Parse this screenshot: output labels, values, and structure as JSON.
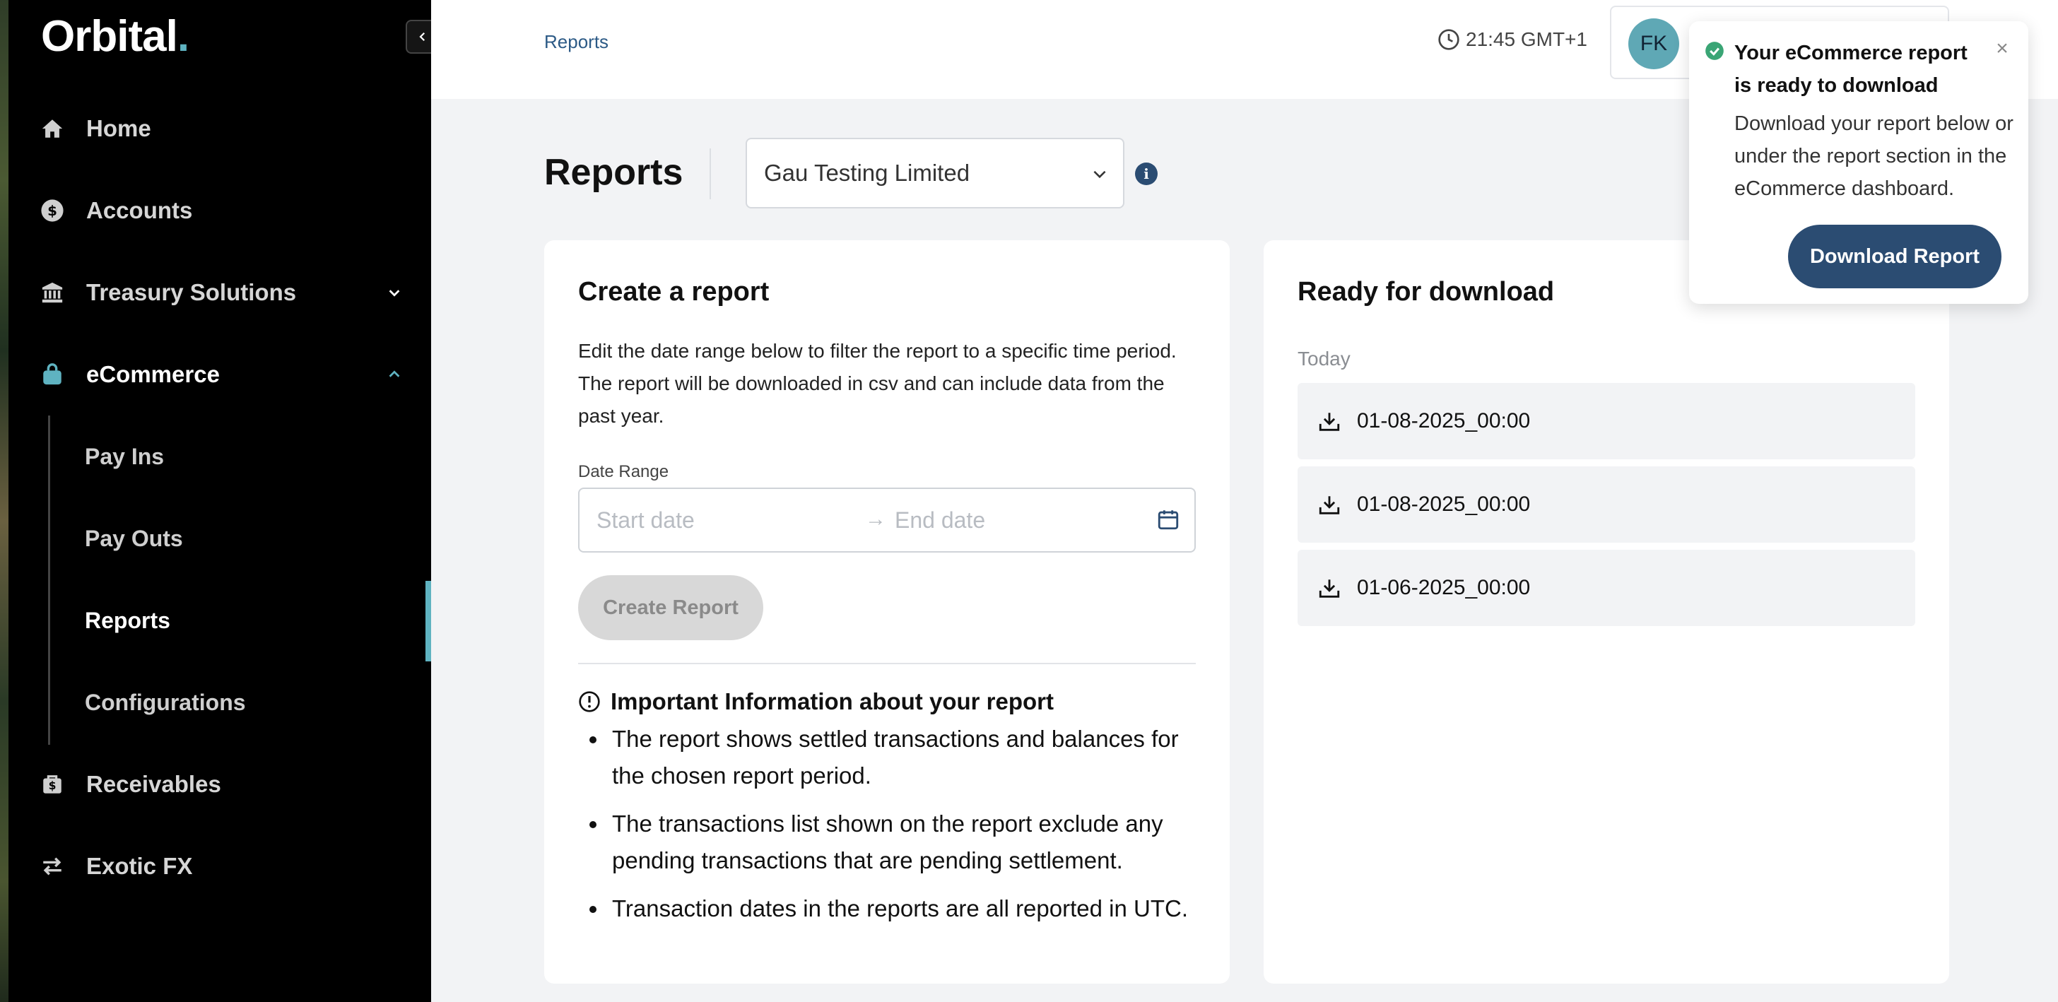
{
  "app": {
    "logo_text": "Orbital",
    "logo_dot": "."
  },
  "sidebar": {
    "items": [
      {
        "label": "Home",
        "icon": "home-icon"
      },
      {
        "label": "Accounts",
        "icon": "dollar-coin-icon"
      },
      {
        "label": "Treasury Solutions",
        "icon": "bank-icon",
        "chevron": "chevron-down-icon"
      },
      {
        "label": "eCommerce",
        "icon": "shopping-bag-icon",
        "chevron": "chevron-up-icon"
      },
      {
        "label": "Receivables",
        "icon": "receivables-icon"
      },
      {
        "label": "Exotic FX",
        "icon": "exchange-arrows-icon"
      }
    ],
    "ecommerce_sub": [
      {
        "label": "Pay Ins"
      },
      {
        "label": "Pay Outs"
      },
      {
        "label": "Reports",
        "active": true
      },
      {
        "label": "Configurations"
      }
    ],
    "accent_color": "#5fb3c1"
  },
  "header": {
    "breadcrumb": "Reports",
    "time": "21:45 GMT+1",
    "user_initials": "FK"
  },
  "page": {
    "title": "Reports",
    "company_select": "Gau Testing Limited"
  },
  "create_report": {
    "title": "Create a report",
    "description": "Edit the date range below to filter the report to a specific time period. The report will be downloaded in csv and can include data from the past year.",
    "date_range_label": "Date Range",
    "start_placeholder": "Start date",
    "arrow": "→",
    "end_placeholder": "End date",
    "button_label": "Create Report",
    "info_title": "Important Information about your report",
    "info_bullets": [
      "The report shows settled transactions and balances for the chosen report period.",
      "The transactions list shown on the report exclude any pending transactions that are pending settlement.",
      "Transaction dates in the reports are all reported in UTC."
    ]
  },
  "ready": {
    "title": "Ready for download",
    "group_label": "Today",
    "files": [
      "01-08-2025_00:00",
      "01-08-2025_00:00",
      "01-06-2025_00:00"
    ]
  },
  "toast": {
    "title": "Your eCommerce report is ready to download",
    "body": "Download your report below or under the report section in the eCommerce dashboard.",
    "button_label": "Download Report",
    "close": "×"
  },
  "colors": {
    "primary": "#2b4c72",
    "success": "#3aa575",
    "sidebar_bg": "#000000"
  }
}
